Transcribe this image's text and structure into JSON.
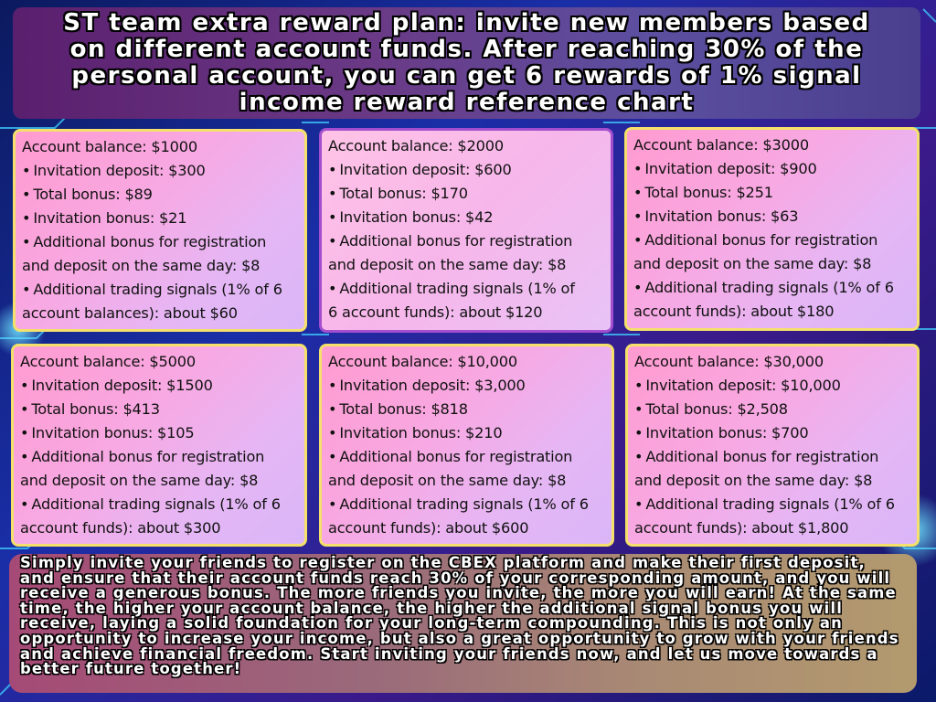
{
  "title": "ST team extra reward plan: invite new members based on different account funds. After reaching 30% of the personal account, you can get 6 rewards of 1% signal income reward reference chart",
  "cards": [
    {
      "balance": "Account balance: $1000",
      "deposit": "Invitation deposit: $300",
      "total": "Total bonus: $89",
      "invitation": "Invitation bonus: $21",
      "additional_a": "Additional bonus for registration",
      "additional_b": "and deposit on the same day: $8",
      "signals_a": "Additional trading signals (1% of 6",
      "signals_b": "account balances): about $60"
    },
    {
      "balance": "Account balance: $2000",
      "deposit": "Invitation deposit: $600",
      "total": "Total bonus: $170",
      "invitation": "Invitation bonus: $42",
      "additional_a": "Additional bonus for registration",
      "additional_b": "and deposit on the same day: $8",
      "signals_a": "Additional trading signals (1% of",
      "signals_b": "6 account funds): about $120"
    },
    {
      "balance": "Account balance: $3000",
      "deposit": "Invitation deposit: $900",
      "total": "Total bonus: $251",
      "invitation": "Invitation bonus: $63",
      "additional_a": "Additional bonus for registration",
      "additional_b": "and deposit on the same day: $8",
      "signals_a": "Additional trading signals (1% of 6",
      "signals_b": "account funds): about $180"
    },
    {
      "balance": "Account balance: $5000",
      "deposit": "Invitation deposit: $1500",
      "total": "Total bonus: $413",
      "invitation": "Invitation bonus: $105",
      "additional_a": "Additional bonus for registration",
      "additional_b": "and deposit on the same day: $8",
      "signals_a": "Additional trading signals (1% of 6",
      "signals_b": "account funds): about $300"
    },
    {
      "balance": "Account balance: $10,000",
      "deposit": "Invitation deposit: $3,000",
      "total": "Total bonus: $818",
      "invitation": "Invitation bonus: $210",
      "additional_a": "Additional bonus for registration",
      "additional_b": "and deposit on the same day: $8",
      "signals_a": "Additional trading signals (1% of 6",
      "signals_b": "account funds): about $600"
    },
    {
      "balance": "Account balance: $30,000",
      "deposit": "Invitation deposit: $10,000",
      "total": "Total bonus: $2,508",
      "invitation": "Invitation bonus: $700",
      "additional_a": "Additional bonus for registration",
      "additional_b": "and deposit on the same day: $8",
      "signals_a": "Additional trading signals (1% of 6",
      "signals_b": "account funds): about $1,800"
    }
  ],
  "bullet": "•",
  "footer": "Simply invite your friends to register on the CBEX platform and make their first deposit, and ensure that their account funds reach 30% of your corresponding amount, and you will receive a generous bonus. The more friends you invite, the more you will earn! At the same time, the higher your account balance, the higher the additional signal bonus you will receive, laying a solid foundation for your long-term compounding. This is not only an opportunity to increase your income, but also a great opportunity to grow with your friends and achieve financial freedom. Start inviting your friends now, and let us move towards a better future together!",
  "colors": {
    "background": "#1a2ea8",
    "circuit_glow": "#3fd0ff",
    "card_border_yellow": "#f4e06a",
    "card_border_purple": "#a24ecf",
    "card_fill": "#f8a8e2"
  }
}
